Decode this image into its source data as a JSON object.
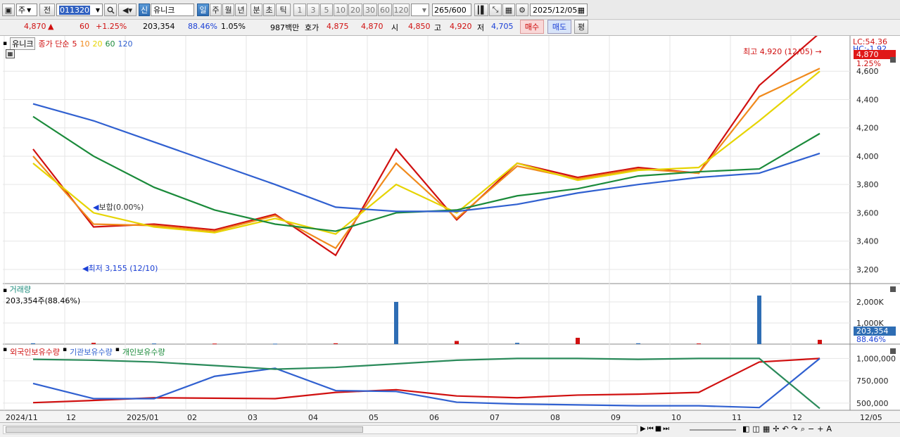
{
  "toolbar": {
    "period_select": "주",
    "prev_label": "전",
    "code": "011320",
    "market_badge": "신",
    "stock_name": "유니크",
    "period_buttons": [
      "일",
      "주",
      "월",
      "년",
      "분",
      "초",
      "틱"
    ],
    "count_buttons": [
      "1",
      "3",
      "5",
      "10",
      "20",
      "30",
      "60",
      "120"
    ],
    "data_count": "265",
    "data_total": "/600",
    "date": "2025/12/05"
  },
  "quote": {
    "price": "4,870",
    "change": "60",
    "change_pct": "+1.25%",
    "volume": "203,354",
    "vol_ratio": "88.46%",
    "turnover_pct": "1.05%",
    "amount": "987백만",
    "bid_label": "호가",
    "bid1": "4,875",
    "bid2": "4,870",
    "open_label": "시",
    "open": "4,850",
    "high_label": "고",
    "high": "4,920",
    "low_label": "저",
    "low": "4,705",
    "buy_label": "매수",
    "sell_label": "매도",
    "avg_label": "평"
  },
  "legend": {
    "name": "유니크",
    "close_label": "종가 단순",
    "ma": [
      {
        "label": "5",
        "color": "#d01010"
      },
      {
        "label": "10",
        "color": "#f08a1c"
      },
      {
        "label": "20",
        "color": "#e6d400"
      },
      {
        "label": "60",
        "color": "#1a8a3a"
      },
      {
        "label": "120",
        "color": "#3060d0"
      }
    ]
  },
  "right_axis": {
    "top_label": "LC:54.36",
    "top_label2": "HC:-1.92",
    "price_tag": "4,870",
    "pct_tag": "1.25%",
    "price_ticks": [
      "4,600",
      "4,400",
      "4,200",
      "4,000",
      "3,800",
      "3,600",
      "3,400",
      "3,200"
    ],
    "volume_ticks": [
      "2,000K",
      "1,000K"
    ],
    "volume_tag": "203,354",
    "volume_pct_tag": "88.46%",
    "holdings_ticks": [
      "1,000,000",
      "750,000",
      "500,000"
    ]
  },
  "annotations": {
    "high": "최고 4,920 (12/05)",
    "low": "최저 3,155 (12/10)",
    "flat": "보합(0.00%)"
  },
  "volume_panel": {
    "title": "거래량",
    "value": "203,354주(88.46%)"
  },
  "holdings_panel": {
    "series": [
      "외국인보유수량",
      "기관보유수량",
      "개인보유수량"
    ]
  },
  "x_axis": [
    "2024/11",
    "12",
    "2025/01",
    "02",
    "03",
    "04",
    "05",
    "06",
    "07",
    "08",
    "09",
    "10",
    "11",
    "12",
    "12/05"
  ],
  "chart_data": [
    {
      "type": "line",
      "title": "유니크",
      "series_labels": "종가 단순 5 10 20 60 120",
      "x": [
        "2024/11",
        "12",
        "2025/01",
        "02",
        "03",
        "04",
        "05",
        "06",
        "07",
        "08",
        "09",
        "10",
        "11",
        "12"
      ],
      "series": [
        {
          "name": "5",
          "values": [
            4050,
            3500,
            3520,
            3480,
            3590,
            3300,
            4050,
            3550,
            3950,
            3850,
            3920,
            3880,
            4500,
            4870
          ]
        },
        {
          "name": "10",
          "values": [
            4000,
            3520,
            3510,
            3470,
            3580,
            3350,
            3950,
            3560,
            3930,
            3840,
            3910,
            3880,
            4420,
            4620
          ]
        },
        {
          "name": "20",
          "values": [
            3950,
            3600,
            3500,
            3460,
            3560,
            3450,
            3800,
            3600,
            3950,
            3830,
            3900,
            3920,
            4250,
            4600
          ]
        },
        {
          "name": "60",
          "values": [
            4280,
            4000,
            3780,
            3620,
            3520,
            3470,
            3600,
            3620,
            3720,
            3770,
            3860,
            3890,
            3910,
            4160
          ]
        },
        {
          "name": "120",
          "values": [
            4370,
            4250,
            4100,
            3950,
            3800,
            3640,
            3610,
            3610,
            3660,
            3740,
            3800,
            3850,
            3880,
            4020
          ]
        }
      ],
      "ylim": [
        3100,
        4800
      ],
      "high": {
        "value": 4920,
        "date": "12/05"
      },
      "low": {
        "value": 3155,
        "date": "12/10"
      }
    },
    {
      "type": "bar",
      "title": "거래량",
      "x": [
        "2024/11",
        "12",
        "2025/01",
        "02",
        "03",
        "04",
        "05",
        "06",
        "07",
        "08",
        "09",
        "10",
        "11",
        "12"
      ],
      "values": [
        40,
        60,
        30,
        25,
        20,
        40,
        2000,
        150,
        60,
        300,
        40,
        30,
        2300,
        203
      ],
      "unit": "K",
      "ylim": [
        0,
        2400
      ]
    },
    {
      "type": "line",
      "x": [
        "2024/11",
        "12",
        "2025/01",
        "02",
        "03",
        "04",
        "05",
        "06",
        "07",
        "08",
        "09",
        "10",
        "11",
        "12"
      ],
      "series": [
        {
          "name": "외국인보유수량",
          "values": [
            505000,
            530000,
            560000,
            555000,
            550000,
            620000,
            650000,
            580000,
            560000,
            590000,
            600000,
            620000,
            960000,
            1000000
          ]
        },
        {
          "name": "기관보유수량",
          "values": [
            720000,
            550000,
            550000,
            800000,
            890000,
            640000,
            630000,
            510000,
            490000,
            480000,
            470000,
            470000,
            450000,
            1000000
          ]
        },
        {
          "name": "개인보유수량",
          "values": [
            990000,
            980000,
            960000,
            920000,
            880000,
            900000,
            940000,
            980000,
            1000000,
            1000000,
            990000,
            1000000,
            1000000,
            440000
          ]
        }
      ],
      "ylim": [
        420000,
        1050000
      ]
    }
  ]
}
